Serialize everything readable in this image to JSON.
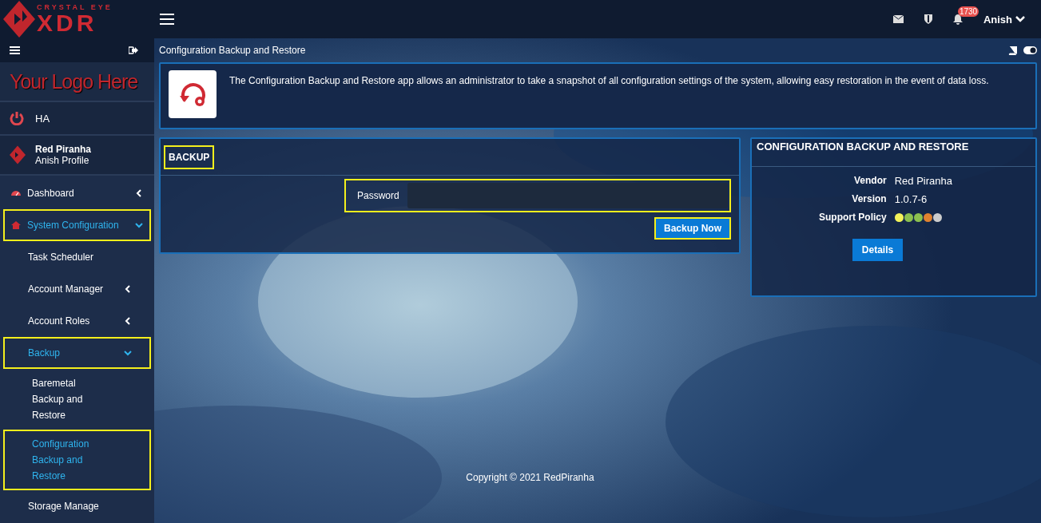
{
  "brand": {
    "tagline": "CRYSTAL EYE",
    "name": "XDR"
  },
  "topbar": {
    "notifications": "1730",
    "user": "Anish"
  },
  "sidebar": {
    "logo_text": "Your Logo Here",
    "ha": "HA",
    "profile": {
      "company": "Red Piranha",
      "name": "Anish Profile"
    },
    "items": [
      {
        "label": "Dashboard",
        "selected": false,
        "highlighted": false,
        "expanded": false
      },
      {
        "label": "System Configuration",
        "selected": true,
        "highlighted": true,
        "expanded": true,
        "children": [
          {
            "label": "Task Scheduler",
            "selected": false,
            "highlighted": false
          },
          {
            "label": "Account Manager",
            "selected": false,
            "highlighted": false,
            "expanded": false
          },
          {
            "label": "Account Roles",
            "selected": false,
            "highlighted": false,
            "expanded": false
          },
          {
            "label": "Backup",
            "selected": true,
            "highlighted": true,
            "expanded": true,
            "children": [
              {
                "label": "Baremetal Backup and Restore",
                "selected": false,
                "highlighted": false
              },
              {
                "label": "Configuration Backup and Restore",
                "selected": true,
                "highlighted": true
              }
            ]
          },
          {
            "label": "Storage Manage",
            "selected": false,
            "highlighted": false
          }
        ]
      }
    ]
  },
  "page": {
    "title": "Configuration Backup and Restore",
    "description": "The Configuration Backup and Restore app allows an administrator to take a snapshot of all configuration settings of the system, allowing easy restoration in the event of data loss."
  },
  "backup": {
    "title": "BACKUP",
    "title_highlighted": true,
    "password_label": "Password",
    "password_highlighted": true,
    "button": "Backup Now",
    "button_highlighted": true
  },
  "info": {
    "title": "CONFIGURATION BACKUP AND RESTORE",
    "vendor_label": "Vendor",
    "vendor": "Red Piranha",
    "version_label": "Version",
    "version": "1.0.7-6",
    "policy_label": "Support Policy",
    "policy": [
      {
        "color": "#f2f25a"
      },
      {
        "color": "#8cbf4f"
      },
      {
        "color": "#8cbf4f"
      },
      {
        "color": "#e0822f"
      },
      {
        "color": "#cccccc"
      }
    ],
    "button": "Details"
  },
  "footer": "Copyright © 2021 RedPiranha"
}
